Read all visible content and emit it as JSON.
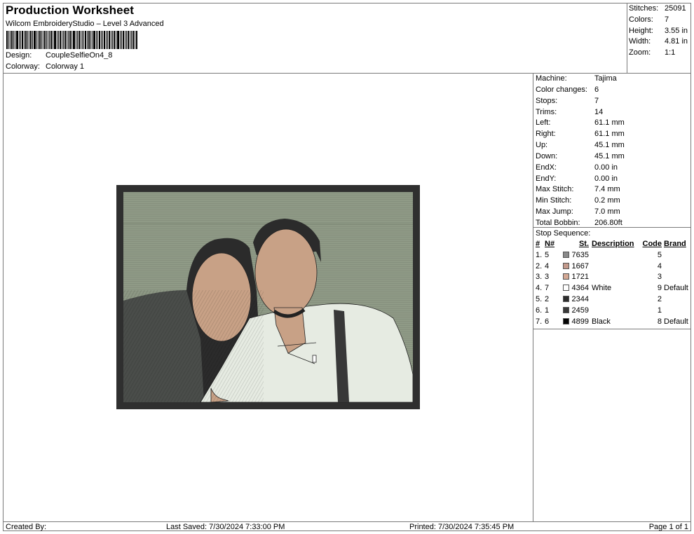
{
  "header": {
    "title": "Production Worksheet",
    "software": "Wilcom EmbroideryStudio – Level 3 Advanced",
    "design_label": "Design:",
    "design_value": "CoupleSelfieOn4_8",
    "colorway_label": "Colorway:",
    "colorway_value": "Colorway 1"
  },
  "summary": {
    "stitches_label": "Stitches:",
    "stitches": "25091",
    "colors_label": "Colors:",
    "colors": "7",
    "height_label": "Height:",
    "height": "3.55 in",
    "width_label": "Width:",
    "width": "4.81 in",
    "zoom_label": "Zoom:",
    "zoom": "1:1"
  },
  "specs": [
    {
      "label": "Machine:",
      "value": "Tajima"
    },
    {
      "label": "Color changes:",
      "value": "6"
    },
    {
      "label": "Stops:",
      "value": "7"
    },
    {
      "label": "Trims:",
      "value": "14"
    },
    {
      "label": "Left:",
      "value": "61.1 mm"
    },
    {
      "label": "Right:",
      "value": "61.1 mm"
    },
    {
      "label": "Up:",
      "value": "45.1 mm"
    },
    {
      "label": "Down:",
      "value": "45.1 mm"
    },
    {
      "label": "EndX:",
      "value": "0.00 in"
    },
    {
      "label": "EndY:",
      "value": "0.00 in"
    },
    {
      "label": "Max Stitch:",
      "value": "7.4 mm"
    },
    {
      "label": "Min Stitch:",
      "value": "0.2 mm"
    },
    {
      "label": "Max Jump:",
      "value": "7.0 mm"
    },
    {
      "label": "Total Bobbin:",
      "value": "206.80ft"
    }
  ],
  "stop_sequence": {
    "title": "Stop Sequence:",
    "columns": [
      "#",
      "N#",
      "St.",
      "Description",
      "Code",
      "Brand"
    ],
    "rows": [
      {
        "num": "1.",
        "n": "5",
        "color": "#8a8a8a",
        "st": "7635",
        "desc": "",
        "code": "5",
        "brand": ""
      },
      {
        "num": "2.",
        "n": "4",
        "color": "#c49a8c",
        "st": "1667",
        "desc": "",
        "code": "4",
        "brand": ""
      },
      {
        "num": "3.",
        "n": "3",
        "color": "#d4a894",
        "st": "1721",
        "desc": "",
        "code": "3",
        "brand": ""
      },
      {
        "num": "4.",
        "n": "7",
        "color": "#ffffff",
        "st": "4364",
        "desc": "White",
        "code": "9",
        "brand": "Default"
      },
      {
        "num": "5.",
        "n": "2",
        "color": "#2e2e2e",
        "st": "2344",
        "desc": "",
        "code": "2",
        "brand": ""
      },
      {
        "num": "6.",
        "n": "1",
        "color": "#3a3a3a",
        "st": "2459",
        "desc": "",
        "code": "1",
        "brand": ""
      },
      {
        "num": "7.",
        "n": "6",
        "color": "#050505",
        "st": "4899",
        "desc": "Black",
        "code": "8",
        "brand": "Default"
      }
    ]
  },
  "footer": {
    "created_by": "Created By:",
    "last_saved": "Last Saved: 7/30/2024 7:33:00 PM",
    "printed": "Printed: 7/30/2024 7:35:45 PM",
    "page": "Page 1 of 1"
  },
  "design_preview": {
    "colors": {
      "border": "#2f2f2f",
      "background": "#8f9a86",
      "skin": "#c8a186",
      "hair": "#2b2b2b",
      "coat": "#4a4d4a",
      "shirt": "#e6ebe2",
      "strap": "#383838"
    }
  }
}
